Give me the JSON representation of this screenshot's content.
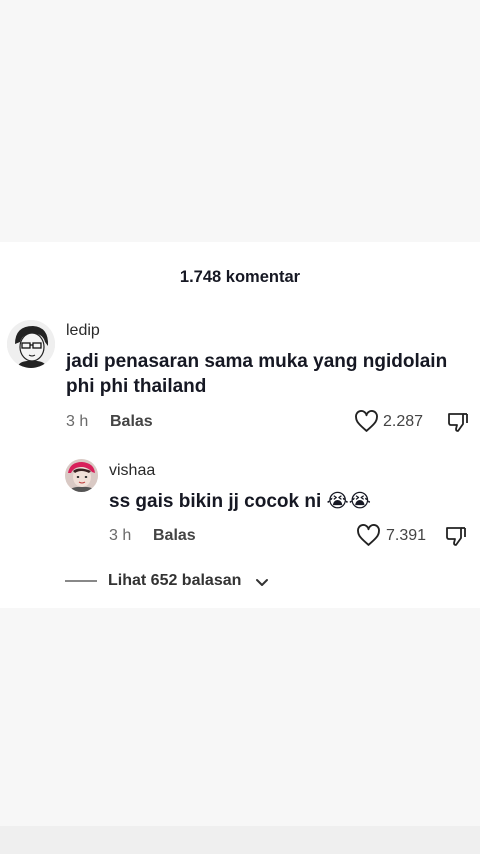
{
  "header": {
    "title": "1.748 komentar"
  },
  "comments": [
    {
      "username": "ledip",
      "text_line1": "jadi penasaran sama muka yang ngidolain",
      "text_line2": "phi phi thailand",
      "time": "3 h",
      "reply_label": "Balas",
      "likes": "2.287"
    }
  ],
  "replies": [
    {
      "username": "vishaa",
      "text": "ss gais bikin jj cocok ni",
      "emoji": "😭😭",
      "time": "3 h",
      "reply_label": "Balas",
      "likes": "7.391"
    }
  ],
  "view_replies": {
    "label": "Lihat 652 balasan"
  },
  "icons": {
    "like": "heart-outline-icon",
    "dislike": "thumbs-down-icon",
    "expand": "chevron-down-icon"
  },
  "colors": {
    "panel": "#ffffff",
    "background": "#f7f7f7",
    "text": "#161823"
  }
}
